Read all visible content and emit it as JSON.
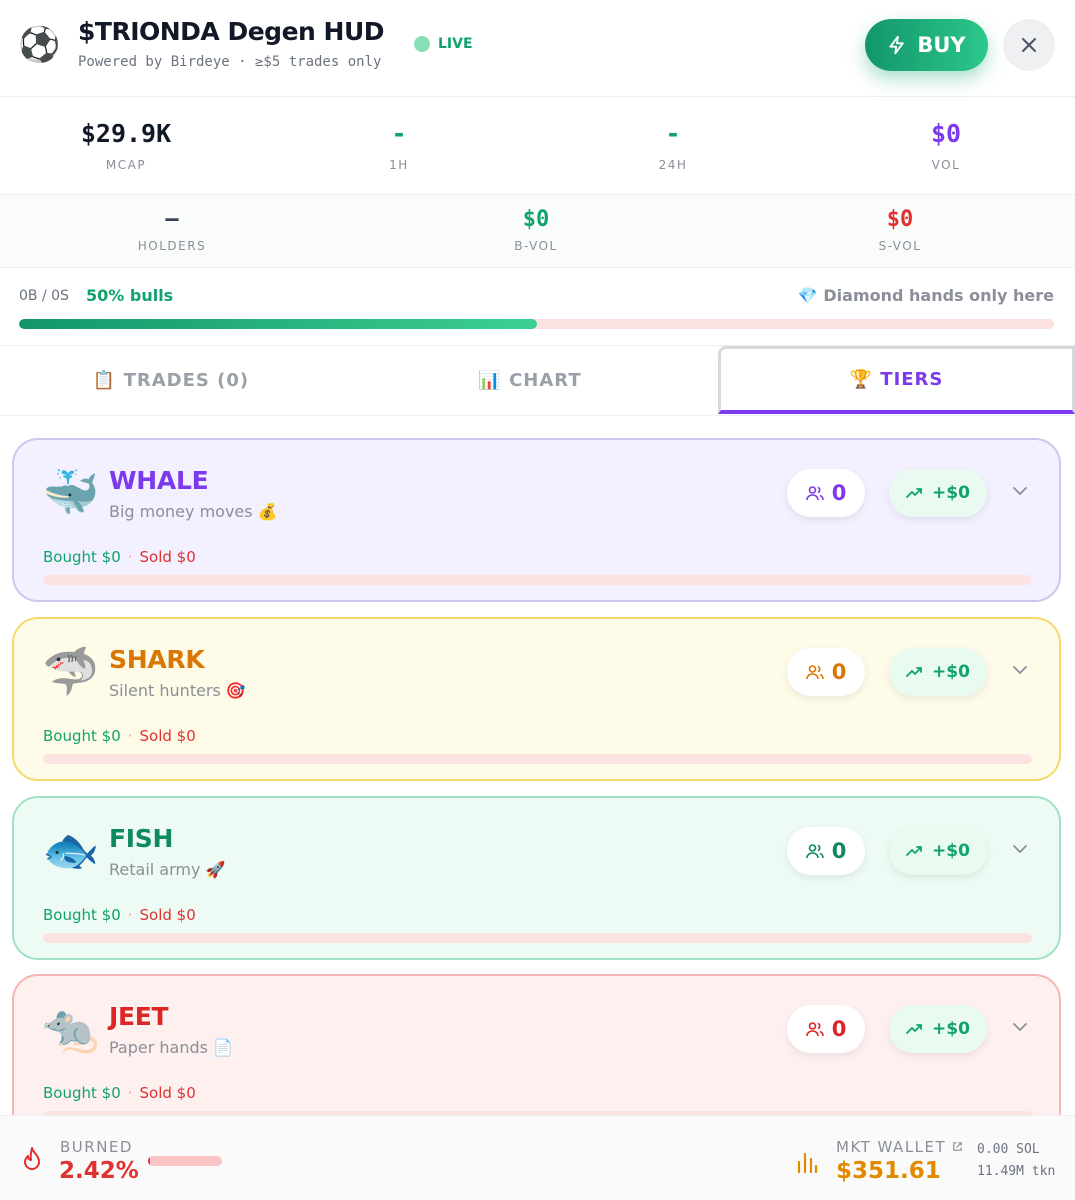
{
  "header": {
    "logo_emoji": "⚽",
    "title": "$TRIONDA Degen HUD",
    "subtitle": "Powered by Birdeye · ≥$5 trades only",
    "live_label": "LIVE",
    "buy_label": "BUY",
    "close_icon": "close-icon",
    "buy_icon": "lightning-icon"
  },
  "stats_top": [
    {
      "value": "$29.9K",
      "label": "MCAP",
      "color": "#111827"
    },
    {
      "value": "-",
      "label": "1H",
      "color": "#10a36b"
    },
    {
      "value": "-",
      "label": "24H",
      "color": "#10a36b"
    },
    {
      "value": "$0",
      "label": "VOL",
      "color": "#7c3aed"
    }
  ],
  "stats_bottom": [
    {
      "value": "—",
      "label": "HOLDERS",
      "color": "#374151"
    },
    {
      "value": "$0",
      "label": "B-VOL",
      "color": "#10a36b"
    },
    {
      "value": "$0",
      "label": "S-VOL",
      "color": "#e03131"
    }
  ],
  "sentiment": {
    "buy_sell_count": "0B / 0S",
    "bulls_label": "50% bulls",
    "bull_fraction": 0.5,
    "tagline": "💎 Diamond hands only here"
  },
  "tabs": [
    {
      "label": "📋 TRADES (0)",
      "active": false
    },
    {
      "label": "📊 CHART",
      "active": false
    },
    {
      "label": "🏆 TIERS",
      "active": true
    }
  ],
  "tiers": [
    {
      "emoji": "🐳",
      "name": "WHALE",
      "desc": "Big money moves 💰",
      "users": "0",
      "pnl": "+$0",
      "bought": "Bought $0",
      "sep": "·",
      "sold": "Sold $0",
      "buy_fraction": 0,
      "accent": "#7c3aed",
      "bg": "#f3f0ff",
      "border": "#cfc5f0"
    },
    {
      "emoji": "🦈",
      "name": "SHARK",
      "desc": "Silent hunters 🎯",
      "users": "0",
      "pnl": "+$0",
      "bought": "Bought $0",
      "sep": "·",
      "sold": "Sold $0",
      "buy_fraction": 0,
      "accent": "#d97706",
      "bg": "#fefbe8",
      "border": "#f5d96b"
    },
    {
      "emoji": "🐟",
      "name": "FISH",
      "desc": "Retail army 🚀",
      "users": "0",
      "pnl": "+$0",
      "bought": "Bought $0",
      "sep": "·",
      "sold": "Sold $0",
      "buy_fraction": 0,
      "accent": "#0f8a5f",
      "bg": "#eefbf4",
      "border": "#9fe3c4"
    },
    {
      "emoji": "🐀",
      "name": "JEET",
      "desc": "Paper hands 📄",
      "users": "0",
      "pnl": "+$0",
      "bought": "Bought $0",
      "sep": "·",
      "sold": "Sold $0",
      "buy_fraction": 0,
      "accent": "#dc2626",
      "bg": "#fff0f0",
      "border": "#f5b5b5"
    }
  ],
  "footer": {
    "burned_label": "BURNED",
    "burned_value": "2.42%",
    "burned_fraction": 0.0242,
    "mkt_label": "MKT WALLET",
    "mkt_value": "$351.61",
    "mkt_sol": "0.00 SOL",
    "mkt_tkn": "11.49M tkn",
    "flame_icon": "flame-icon",
    "chart_icon": "bar-chart-icon",
    "link_icon": "external-link-icon"
  }
}
